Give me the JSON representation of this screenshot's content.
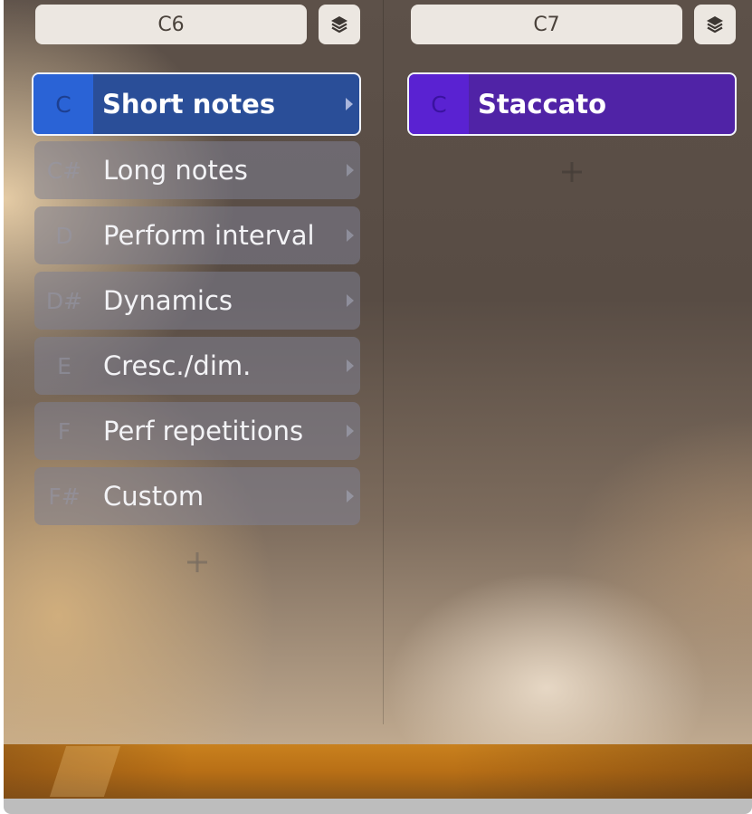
{
  "columns": {
    "left": {
      "octave": "C6",
      "add_label": "+",
      "items": [
        {
          "key": "C",
          "label": "Short notes"
        },
        {
          "key": "C#",
          "label": "Long notes"
        },
        {
          "key": "D",
          "label": "Perform interval"
        },
        {
          "key": "D#",
          "label": "Dynamics"
        },
        {
          "key": "E",
          "label": "Cresc./dim."
        },
        {
          "key": "F",
          "label": "Perf repetitions"
        },
        {
          "key": "F#",
          "label": "Custom"
        }
      ]
    },
    "right": {
      "octave": "C7",
      "add_label": "+",
      "items": [
        {
          "key": "C",
          "label": "Staccato"
        }
      ]
    }
  },
  "colors": {
    "active_blue": "#2a4e98",
    "active_purple": "#5023a6",
    "item_gray": "#7d8092"
  },
  "icons": {
    "layers": "layers-icon",
    "arrow": "chevron-right-icon",
    "add": "plus-icon"
  }
}
